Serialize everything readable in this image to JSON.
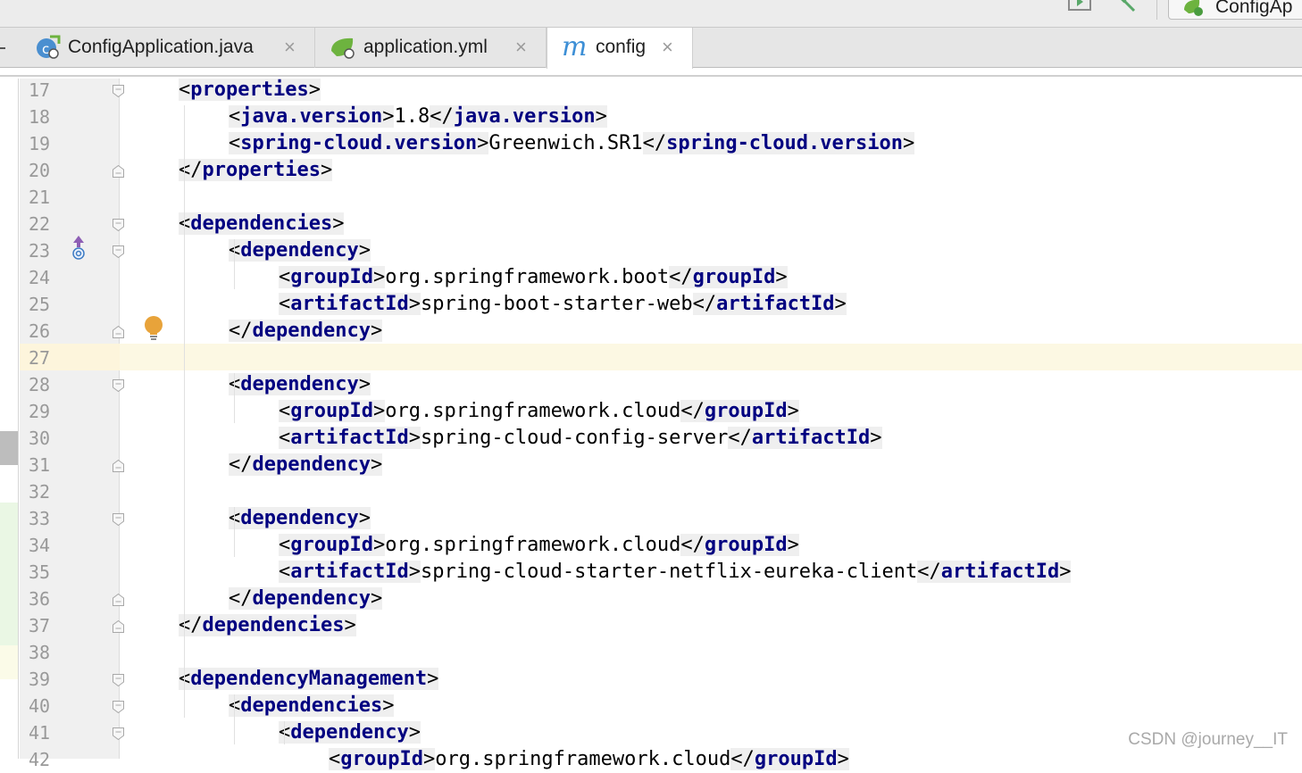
{
  "toolbar": {
    "run_config_label": "ConfigAp",
    "run_icon": "run-icon",
    "build_icon": "hammer-icon"
  },
  "tabs": [
    {
      "label": "ConfigApplication.java",
      "icon": "spring-boot-class-icon",
      "active": false
    },
    {
      "label": "application.yml",
      "icon": "spring-boot-yml-icon",
      "active": false
    },
    {
      "label": "config",
      "icon": "maven-icon",
      "active": true
    }
  ],
  "tab_close_glyph": "×",
  "colors": {
    "tag": "#000080",
    "line_number": "#999999",
    "caret_row": "#fcf8e3",
    "tag_highlight": "#efefef",
    "gutter": "#f0f0f0"
  },
  "code": {
    "lines": [
      {
        "n": "17",
        "indent": 1,
        "open": "properties",
        "text": "",
        "close": ""
      },
      {
        "n": "18",
        "indent": 2,
        "open": "java.version",
        "text": "1.8",
        "close": "java.version"
      },
      {
        "n": "19",
        "indent": 2,
        "open": "spring-cloud.version",
        "text": "Greenwich.SR1",
        "close": "spring-cloud.version"
      },
      {
        "n": "20",
        "indent": 1,
        "open": "",
        "text": "",
        "close": "properties"
      },
      {
        "n": "21",
        "indent": 0,
        "open": "",
        "text": "",
        "close": ""
      },
      {
        "n": "22",
        "indent": 1,
        "open": "dependencies",
        "text": "",
        "close": ""
      },
      {
        "n": "23",
        "indent": 2,
        "open": "dependency",
        "text": "",
        "close": ""
      },
      {
        "n": "24",
        "indent": 3,
        "open": "groupId",
        "text": "org.springframework.boot",
        "close": "groupId"
      },
      {
        "n": "25",
        "indent": 3,
        "open": "artifactId",
        "text": "spring-boot-starter-web",
        "close": "artifactId"
      },
      {
        "n": "26",
        "indent": 2,
        "open": "",
        "text": "",
        "close": "dependency"
      },
      {
        "n": "27",
        "indent": 0,
        "open": "",
        "text": "",
        "close": ""
      },
      {
        "n": "28",
        "indent": 2,
        "open": "dependency",
        "text": "",
        "close": ""
      },
      {
        "n": "29",
        "indent": 3,
        "open": "groupId",
        "text": "org.springframework.cloud",
        "close": "groupId"
      },
      {
        "n": "30",
        "indent": 3,
        "open": "artifactId",
        "text": "spring-cloud-config-server",
        "close": "artifactId"
      },
      {
        "n": "31",
        "indent": 2,
        "open": "",
        "text": "",
        "close": "dependency"
      },
      {
        "n": "32",
        "indent": 0,
        "open": "",
        "text": "",
        "close": ""
      },
      {
        "n": "33",
        "indent": 2,
        "open": "dependency",
        "text": "",
        "close": ""
      },
      {
        "n": "34",
        "indent": 3,
        "open": "groupId",
        "text": "org.springframework.cloud",
        "close": "groupId"
      },
      {
        "n": "35",
        "indent": 3,
        "open": "artifactId",
        "text": "spring-cloud-starter-netflix-eureka-client",
        "close": "artifactId"
      },
      {
        "n": "36",
        "indent": 2,
        "open": "",
        "text": "",
        "close": "dependency"
      },
      {
        "n": "37",
        "indent": 1,
        "open": "",
        "text": "",
        "close": "dependencies"
      },
      {
        "n": "38",
        "indent": 0,
        "open": "",
        "text": "",
        "close": ""
      },
      {
        "n": "39",
        "indent": 1,
        "open": "dependencyManagement",
        "text": "",
        "close": ""
      },
      {
        "n": "40",
        "indent": 2,
        "open": "dependencies",
        "text": "",
        "close": ""
      },
      {
        "n": "41",
        "indent": 3,
        "open": "dependency",
        "text": "",
        "close": ""
      },
      {
        "n": "42",
        "indent": 4,
        "open": "groupId",
        "text": "org.springframework.cloud",
        "close": "groupId"
      }
    ],
    "fold_open_lines": [
      "17",
      "22",
      "23",
      "28",
      "33",
      "39",
      "40",
      "41"
    ],
    "fold_close_lines": [
      "20",
      "26",
      "31",
      "36",
      "37"
    ],
    "caret_line": "27",
    "override_icon_line": "23",
    "intention_bulb_line": "26"
  },
  "watermark": "CSDN @journey__IT"
}
